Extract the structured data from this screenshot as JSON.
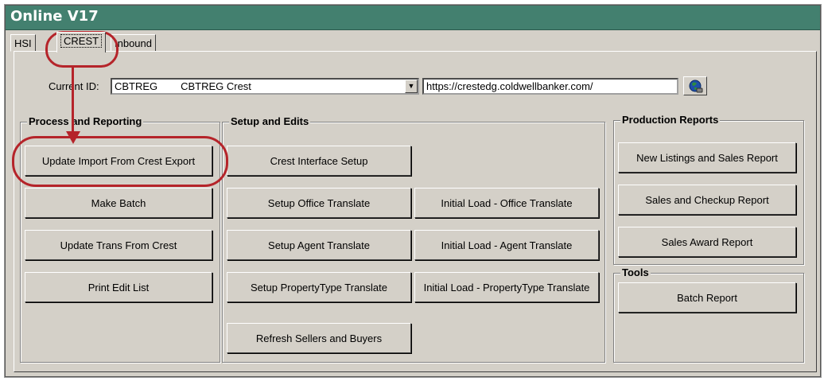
{
  "window": {
    "title": "Online V17"
  },
  "tabs": [
    {
      "label": "HSI",
      "active": false
    },
    {
      "label": "CREST",
      "active": true
    },
    {
      "label": "Inbound",
      "active": false
    }
  ],
  "current_id": {
    "label": "Current ID:",
    "value": "CBTREG        CBTREG Crest",
    "url": "https://crestedg.coldwellbanker.com/"
  },
  "groups": {
    "process": {
      "title": "Process and Reporting",
      "buttons": [
        "Update Import From Crest Export",
        "Make Batch",
        "Update Trans From Crest",
        "Print Edit List"
      ]
    },
    "setup": {
      "title": "Setup and Edits",
      "buttons": [
        "Crest Interface Setup",
        "Setup Office Translate",
        "Initial Load - Office Translate",
        "Setup Agent Translate",
        "Initial Load - Agent Translate",
        "Setup PropertyType Translate",
        "Initial Load - PropertyType Translate",
        "Refresh Sellers and Buyers"
      ]
    },
    "production": {
      "title": "Production Reports",
      "buttons": [
        "New Listings and Sales Report",
        "Sales and Checkup Report",
        "Sales Award Report"
      ]
    },
    "tools": {
      "title": "Tools",
      "buttons": [
        "Batch Report"
      ]
    }
  },
  "colors": {
    "titlebar": "#43806f",
    "callout": "#b5242a",
    "panel": "#d4d0c8"
  },
  "icons": {
    "combo": "chevron-down-icon",
    "globe": "globe-icon"
  }
}
